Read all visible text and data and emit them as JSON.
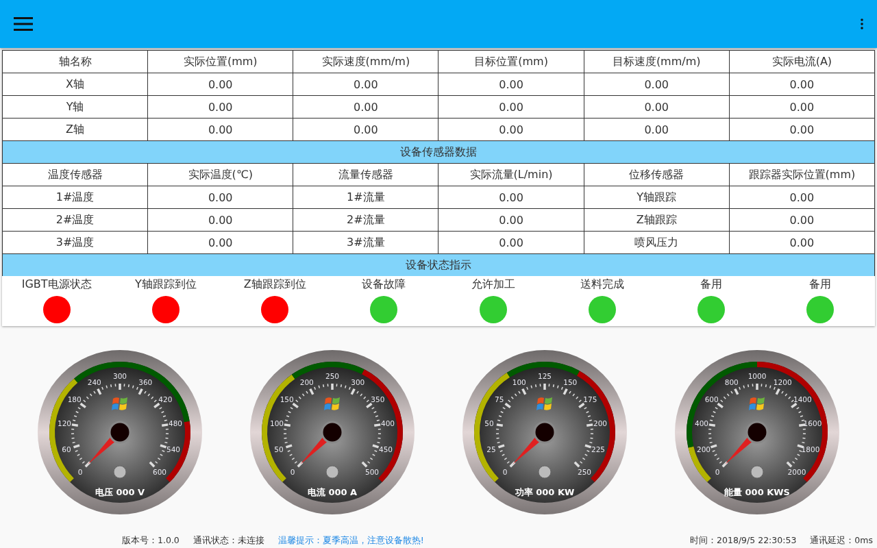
{
  "axis_table": {
    "columns": [
      "轴名称",
      "实际位置(mm)",
      "实际速度(mm/m)",
      "目标位置(mm)",
      "目标速度(mm/m)",
      "实际电流(A)"
    ],
    "rows": [
      [
        "X轴",
        "0.00",
        "0.00",
        "0.00",
        "0.00",
        "0.00"
      ],
      [
        "Y轴",
        "0.00",
        "0.00",
        "0.00",
        "0.00",
        "0.00"
      ],
      [
        "Z轴",
        "0.00",
        "0.00",
        "0.00",
        "0.00",
        "0.00"
      ]
    ]
  },
  "sensor_section": {
    "title": "设备传感器数据",
    "columns": [
      "温度传感器",
      "实际温度(℃)",
      "流量传感器",
      "实际流量(L/min)",
      "位移传感器",
      "跟踪器实际位置(mm)"
    ],
    "rows": [
      [
        "1#温度",
        "0.00",
        "1#流量",
        "0.00",
        "Y轴跟踪",
        "0.00"
      ],
      [
        "2#温度",
        "0.00",
        "2#流量",
        "0.00",
        "Z轴跟踪",
        "0.00"
      ],
      [
        "3#温度",
        "0.00",
        "3#流量",
        "0.00",
        "喷风压力",
        "0.00"
      ]
    ]
  },
  "status_section": {
    "title": "设备状态指示",
    "indicators": [
      {
        "label": "IGBT电源状态",
        "color": "#ff0000"
      },
      {
        "label": "Y轴跟踪到位",
        "color": "#ff0000"
      },
      {
        "label": "Z轴跟踪到位",
        "color": "#ff0000"
      },
      {
        "label": "设备故障",
        "color": "#32cd32"
      },
      {
        "label": "允许加工",
        "color": "#32cd32"
      },
      {
        "label": "送料完成",
        "color": "#32cd32"
      },
      {
        "label": "备用",
        "color": "#32cd32"
      },
      {
        "label": "备用",
        "color": "#32cd32"
      }
    ]
  },
  "gauges": [
    {
      "title": "电压 000 V",
      "ticks": [
        "0",
        "60",
        "120",
        "180",
        "240",
        "300",
        "360",
        "420",
        "480",
        "540",
        "600"
      ]
    },
    {
      "title": "电流 000 A",
      "ticks": [
        "0",
        "50",
        "100",
        "150",
        "200",
        "250",
        "300",
        "350",
        "400",
        "450",
        "500"
      ]
    },
    {
      "title": "功率 000 KW",
      "ticks": [
        "0",
        "25",
        "50",
        "75",
        "100",
        "125",
        "150",
        "175",
        "200",
        "225",
        "250"
      ]
    },
    {
      "title": "能量 000 KWS",
      "ticks": [
        "0",
        "200",
        "400",
        "600",
        "800",
        "1000",
        "1200",
        "1400",
        "1600",
        "1800",
        "2000"
      ]
    }
  ],
  "status_bar": {
    "version": "版本号：1.0.0",
    "comm_status": "通讯状态：未连接",
    "tip": "温馨提示：夏季高温，注意设备散热!",
    "time": "时间：2018/9/5 22:30:53",
    "latency": "通讯延迟：0ms"
  }
}
